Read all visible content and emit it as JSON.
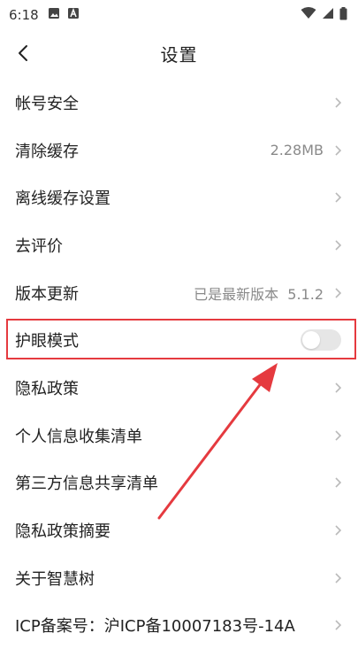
{
  "status_bar": {
    "time": "6:18",
    "icons": [
      "image-icon",
      "a-app-icon",
      "wifi-icon",
      "signal-icon",
      "battery-icon"
    ]
  },
  "header": {
    "title": "设置",
    "back_icon": "chevron-left-icon"
  },
  "settings": {
    "items": [
      {
        "label": "帐号安全",
        "value": ""
      },
      {
        "label": "清除缓存",
        "value": "2.28MB"
      },
      {
        "label": "离线缓存设置",
        "value": ""
      },
      {
        "label": "去评价",
        "value": ""
      },
      {
        "label": "版本更新",
        "value": "已是最新版本  5.1.2"
      },
      {
        "label": "护眼模式",
        "toggle": false
      },
      {
        "label": "隐私政策",
        "value": ""
      },
      {
        "label": "个人信息收集清单",
        "value": ""
      },
      {
        "label": "第三方信息共享清单",
        "value": ""
      },
      {
        "label": "隐私政策摘要",
        "value": ""
      },
      {
        "label": "关于智慧树",
        "value": ""
      },
      {
        "label": "ICP备案号：沪ICP备10007183号-14A",
        "value": ""
      }
    ]
  },
  "colors": {
    "annotation": "#e53a3f",
    "chevron": "#b9b9b9",
    "toggle_off": "#e6e6e6"
  }
}
